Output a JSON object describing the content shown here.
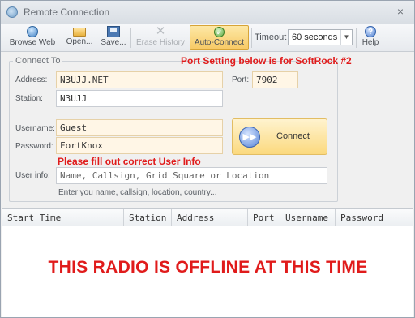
{
  "window": {
    "title": "Remote Connection",
    "close_glyph": "×"
  },
  "toolbar": {
    "browse_web": "Browse Web",
    "open": "Open...",
    "save": "Save...",
    "erase_history": "Erase History",
    "auto_connect": "Auto-Connect",
    "timeout_label": "Timeout",
    "timeout_value": "60 seconds",
    "help": "Help",
    "icons": {
      "browse_web": "globe-icon",
      "open": "folder-icon",
      "save": "floppy-disk-icon",
      "erase_history": "close-icon",
      "auto_connect": "checkmark-icon",
      "help": "question-icon"
    }
  },
  "connect_to": {
    "group_title": "Connect To",
    "port_note": "Port Setting below is for SoftRock #2",
    "address_label": "Address:",
    "address_value": "N3UJJ.NET",
    "port_label": "Port:",
    "port_value": "7902",
    "station_label": "Station:",
    "station_value": "N3UJJ",
    "username_label": "Username:",
    "username_value": "Guest",
    "password_label": "Password:",
    "password_value": "FortKnox",
    "userinfo_note": "Please fill out correct User Info",
    "userinfo_label": "User info:",
    "userinfo_placeholder": "Name, Callsign, Grid Square or Location",
    "hint": "Enter you name, callsign, location, country...",
    "connect_button": "Connect"
  },
  "history_table": {
    "columns": [
      "Start Time",
      "Station",
      "Address",
      "Port",
      "Username",
      "Password"
    ],
    "rows": []
  },
  "offline_message": "THIS RADIO IS OFFLINE AT THIS TIME",
  "colors": {
    "accent_red": "#e01b1b",
    "active_button": "#f7c964"
  }
}
